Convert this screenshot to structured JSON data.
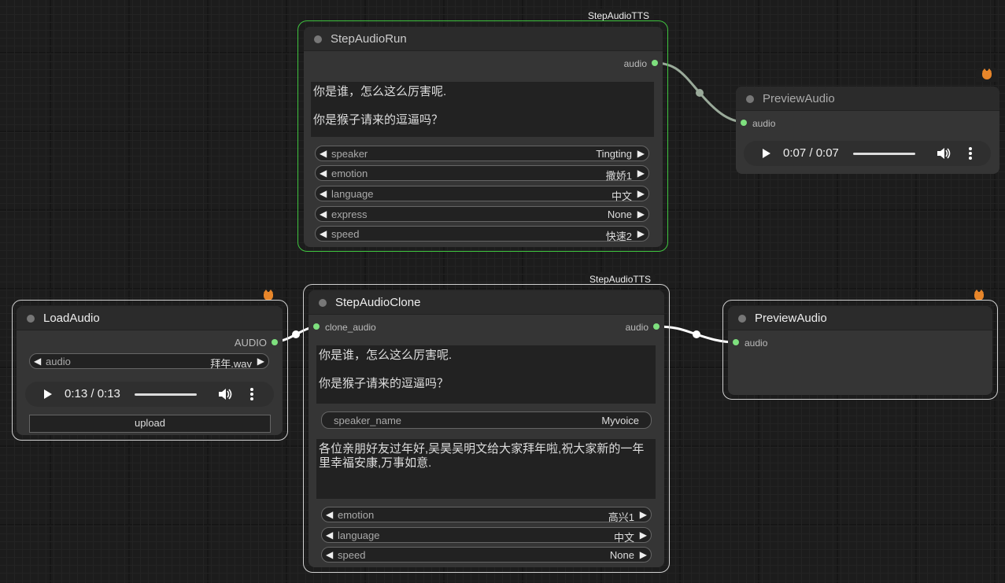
{
  "nodes": {
    "step_run": {
      "badge": "StepAudioTTS",
      "title": "StepAudioRun",
      "output_label": "audio",
      "text": "你是谁，怎么这么厉害呢.\n\n你是猴子请来的逗逼吗？",
      "widgets": [
        {
          "label": "speaker",
          "value": "Tingting"
        },
        {
          "label": "emotion",
          "value": "撒娇1"
        },
        {
          "label": "language",
          "value": "中文"
        },
        {
          "label": "express",
          "value": "None"
        },
        {
          "label": "speed",
          "value": "快速2"
        }
      ]
    },
    "preview_top": {
      "title": "PreviewAudio",
      "input_label": "audio",
      "time": "0:07 / 0:07",
      "progress": 1.0
    },
    "load_audio": {
      "title": "LoadAudio",
      "output_label": "AUDIO",
      "widget": {
        "label": "audio",
        "value": "拜年.wav"
      },
      "time": "0:13 / 0:13",
      "progress": 1.0,
      "upload_label": "upload"
    },
    "step_clone": {
      "badge": "StepAudioTTS",
      "title": "StepAudioClone",
      "input_label": "clone_audio",
      "output_label": "audio",
      "text": "你是谁，怎么这么厉害呢.\n\n你是猴子请来的逗逼吗？",
      "speaker_name": {
        "label": "speaker_name",
        "value": "Myvoice"
      },
      "prompt_text": "各位亲朋好友过年好,吴昊吴明文给大家拜年啦,祝大家新的一年里幸福安康,万事如意.",
      "widgets": [
        {
          "label": "emotion",
          "value": "高兴1"
        },
        {
          "label": "language",
          "value": "中文"
        },
        {
          "label": "speed",
          "value": "None"
        }
      ]
    },
    "preview_bottom": {
      "title": "PreviewAudio",
      "input_label": "audio"
    }
  },
  "icons": {
    "arrow_left": "◀",
    "arrow_right": "▶"
  },
  "colors": {
    "canvas": "#1c1c1c",
    "node_bg": "#353535",
    "selected_outline": "#3fc43f",
    "link": "#ffffff",
    "link_run": "#9aaa9a",
    "slot_pin": "#7ee07e"
  }
}
